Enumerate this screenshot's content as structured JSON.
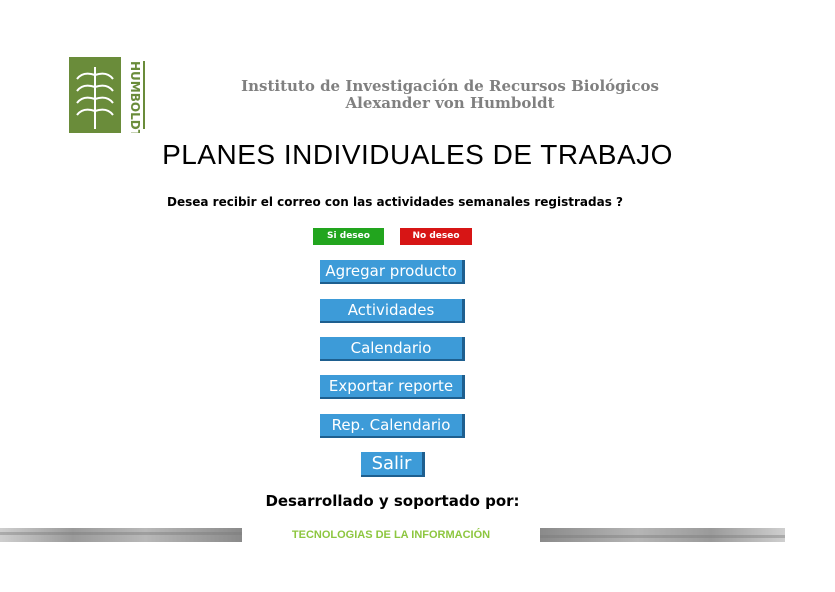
{
  "header": {
    "logo_text": "HUMBOLDT",
    "institution_line1": "Instituto de Investigación de Recursos Biológicos",
    "institution_line2": "Alexander von Humboldt"
  },
  "page": {
    "title": "PLANES INDIVIDUALES DE TRABAJO",
    "question": "Desea recibir el correo con las actividades semanales registradas ?"
  },
  "options": {
    "yes_label": "Si deseo",
    "no_label": "No deseo"
  },
  "menu": {
    "add_product": "Agregar producto",
    "activities": "Actividades",
    "calendar": "Calendario",
    "export_report": "Exportar reporte",
    "calendar_report": "Rep. Calendario",
    "exit": "Salir"
  },
  "footer": {
    "developed_by": "Desarrollado y soportado por:",
    "team": "TECNOLOGIAS DE LA INFORMACIÓN"
  },
  "colors": {
    "logo_green": "#6a8c3a",
    "button_blue": "#3d9bd8",
    "yes_green": "#22a51e",
    "no_red": "#d71515",
    "tech_green": "#8dc63f"
  }
}
